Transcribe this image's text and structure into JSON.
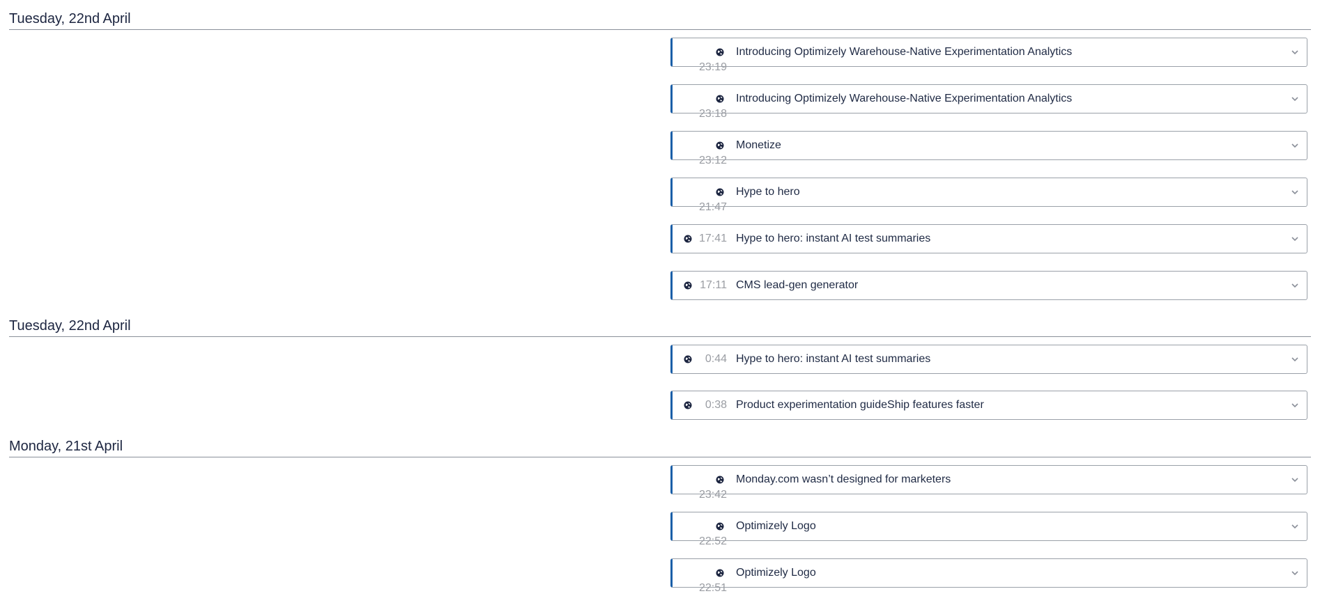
{
  "groups": [
    {
      "title": "Tuesday, 22nd April",
      "items": [
        {
          "time": "23:19",
          "label": "Introducing Optimizely Warehouse-Native Experimentation Analytics"
        },
        {
          "time": "23:18",
          "label": "Introducing Optimizely Warehouse-Native Experimentation Analytics"
        },
        {
          "time": "23:12",
          "label": "Monetize"
        },
        {
          "time": "21:47",
          "label": "Hype to hero"
        },
        {
          "time": "17:41",
          "label": "Hype to hero: instant AI test summaries"
        },
        {
          "time": "17:11",
          "label": "CMS lead-gen generator"
        }
      ]
    },
    {
      "title": "Tuesday, 22nd April",
      "items": [
        {
          "time": "0:44",
          "label": "Hype to hero: instant AI test summaries"
        },
        {
          "time": "0:38",
          "label": "Product experimentation guideShip features faster"
        }
      ]
    },
    {
      "title": "Monday, 21st April",
      "items": [
        {
          "time": "23:42",
          "label": "Monday.com wasn’t designed for marketers"
        },
        {
          "time": "22:52",
          "label": "Optimizely Logo"
        },
        {
          "time": "22:51",
          "label": "Optimizely Logo"
        }
      ]
    }
  ],
  "icons": {
    "item": "globe-icon",
    "expand": "chevron-down-icon"
  },
  "colors": {
    "accent": "#1b5fa8",
    "text": "#1f2a44",
    "muted": "#9a9da3",
    "rule": "#8a8f99"
  }
}
